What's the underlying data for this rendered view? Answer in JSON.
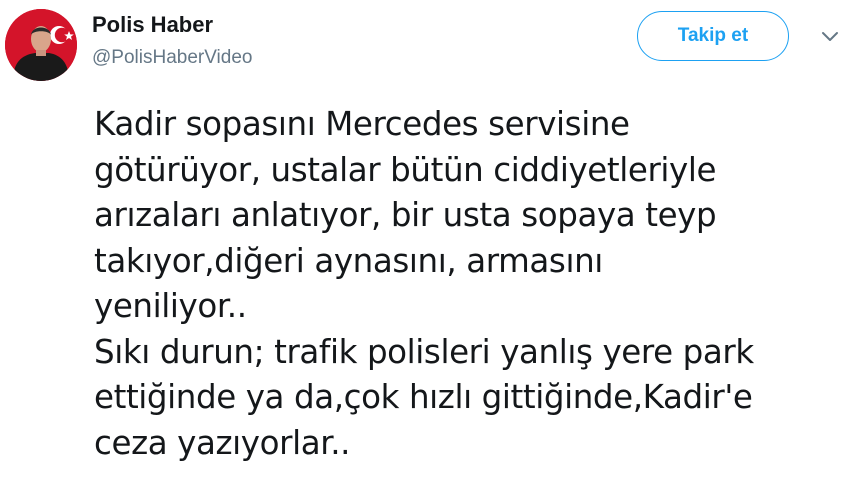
{
  "author": {
    "display_name": "Polis Haber",
    "handle": "@PolisHaberVideo"
  },
  "follow_button": {
    "label": "Takip et"
  },
  "icons": {
    "menu": "chevron-down-icon",
    "avatar": "profile-photo-with-turkish-flag"
  },
  "tweet": {
    "text": "Kadir sopasını Mercedes servisine\ngötürüyor, ustalar bütün ciddiyetleriyle\narızaları anlatıyor, bir usta sopaya teyp\ntakıyor,diğeri aynasını, armasını\nyeniliyor..\nSıkı durun; trafik polisleri yanlış yere park\nettiğinde ya da,çok hızlı gittiğinde,Kadir'e\nceza yazıyorlar.."
  },
  "colors": {
    "accent": "#1da1f2",
    "text": "#14171a",
    "muted": "#657786",
    "flag_red": "#e30a17"
  }
}
